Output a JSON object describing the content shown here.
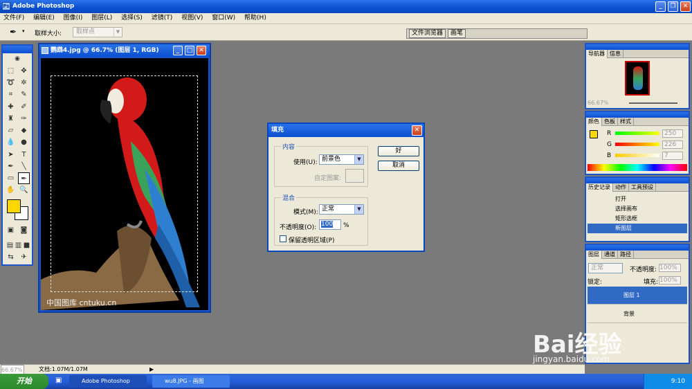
{
  "window": {
    "title": "Adobe Photoshop"
  },
  "menu": [
    "文件(F)",
    "编辑(E)",
    "图像(I)",
    "图层(L)",
    "选择(S)",
    "滤镜(T)",
    "视图(V)",
    "窗口(W)",
    "帮助(H)"
  ],
  "options": {
    "sample_label": "取样大小:",
    "sample_value": "取样点"
  },
  "well_tabs": [
    "文件浏览器",
    "画笔"
  ],
  "document": {
    "title": "鹦鹉4.jpg @ 66.7% (图层 1, RGB)",
    "watermark": "中国图库 cntuku.cn"
  },
  "dialog": {
    "title": "填充",
    "content_group": "内容",
    "use_label": "使用(U):",
    "use_value": "前景色",
    "pattern_label": "自定图案:",
    "blend_group": "混合",
    "mode_label": "模式(M):",
    "mode_value": "正常",
    "opacity_label": "不透明度(O):",
    "opacity_value": "100",
    "opacity_unit": "%",
    "preserve_label": "保留透明区域(P)",
    "ok": "好",
    "cancel": "取消"
  },
  "navigator": {
    "tabs": [
      "导航器",
      "信息"
    ],
    "zoom": "66.67%"
  },
  "color": {
    "tabs": [
      "颜色",
      "色板",
      "样式"
    ],
    "channels": [
      {
        "label": "R",
        "value": "250"
      },
      {
        "label": "G",
        "value": "226"
      },
      {
        "label": "B",
        "value": "7"
      }
    ],
    "foreground": "#ffd700"
  },
  "history": {
    "tabs": [
      "历史记录",
      "动作",
      "工具预设"
    ],
    "items": [
      "打开",
      "选择画布",
      "矩形选框",
      "新图层"
    ]
  },
  "layers": {
    "tabs": [
      "图层",
      "通道",
      "路径"
    ],
    "mode": "正常",
    "opacity_label": "不透明度:",
    "opacity": "100%",
    "lock_label": "锁定:",
    "fill_label": "填充:",
    "fill": "100%",
    "items": [
      "图层 1",
      "背景"
    ]
  },
  "status": {
    "zoom": "66.67%",
    "doc": "文档:1.07M/1.07M"
  },
  "taskbar": {
    "start": "开始",
    "tasks": [
      "Adobe Photoshop",
      "wu8.JPG - 画图"
    ],
    "time": "9:10"
  },
  "watermark": {
    "brand": "Bai经验",
    "url": "jingyan.baidu.com"
  }
}
